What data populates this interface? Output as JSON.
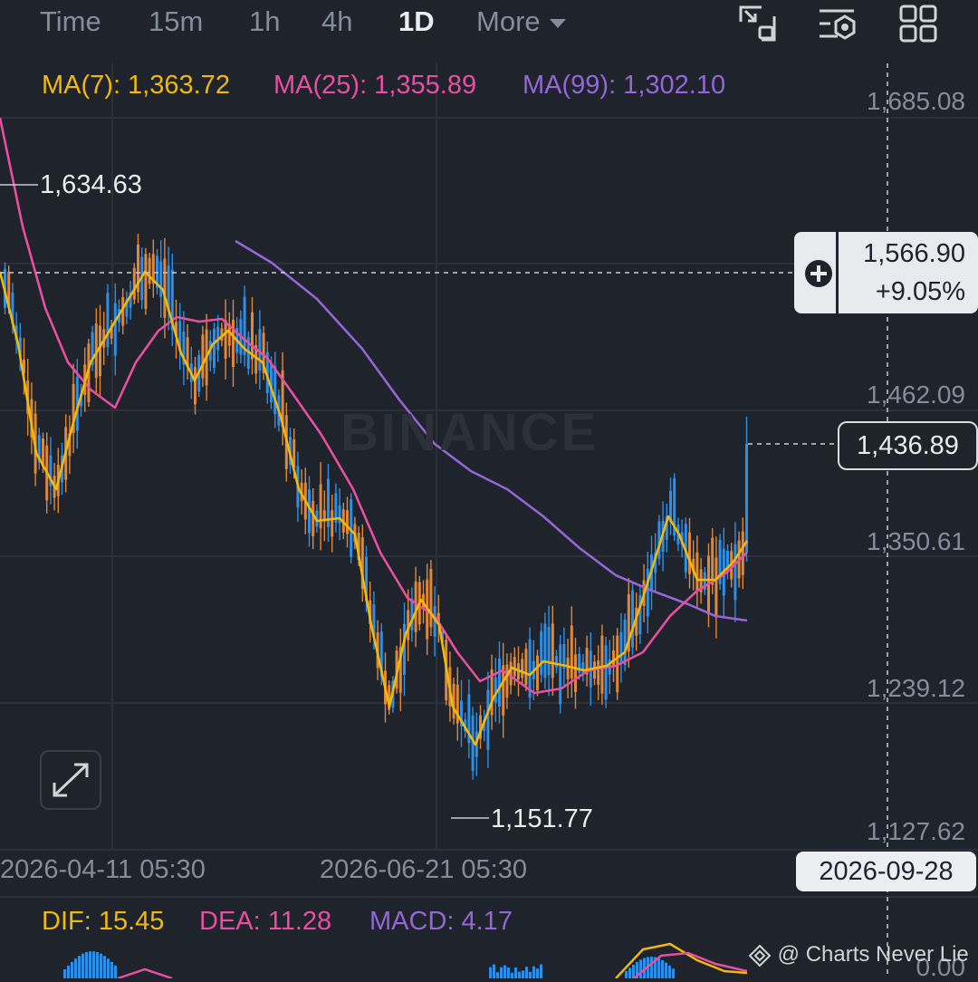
{
  "toolbar": {
    "tabs": [
      {
        "label": "Time"
      },
      {
        "label": "15m"
      },
      {
        "label": "1h"
      },
      {
        "label": "4h"
      },
      {
        "label": "1D"
      },
      {
        "label": "More"
      }
    ],
    "active_tab": "1D",
    "icons": [
      "fullscreen-icon",
      "indicator-settings-icon",
      "layout-grid-icon"
    ]
  },
  "indicators": {
    "ma7_label": "MA(7): 1,363.72",
    "ma25_label": "MA(25): 1,355.89",
    "ma99_label": "MA(99): 1,302.10",
    "ma7_color": "#f0b90b",
    "ma25_color": "#e84fa3",
    "ma99_color": "#9466d6"
  },
  "price_axis": [
    "1,685.08",
    "1,462.09",
    "1,350.61",
    "1,239.12",
    "1,127.62"
  ],
  "crosshair": {
    "price": "1,566.90",
    "change": "+9.05%",
    "date": "2026-09-28"
  },
  "current_price": "1,436.89",
  "high_marker": "1,634.63",
  "low_marker": "1,151.77",
  "date_axis": [
    "2026-04-11 05:30",
    "2026-06-21 05:30"
  ],
  "watermark": "BINANCE",
  "macd": {
    "dif_label": "DIF: 15.45",
    "dea_label": "DEA: 11.28",
    "macd_label": "MACD: 4.17",
    "zero_label": "0.00"
  },
  "credit": "@ Charts Never Lie",
  "colors": {
    "up": "#2e8fe6",
    "down": "#e0883a",
    "background": "#1f232b"
  }
}
